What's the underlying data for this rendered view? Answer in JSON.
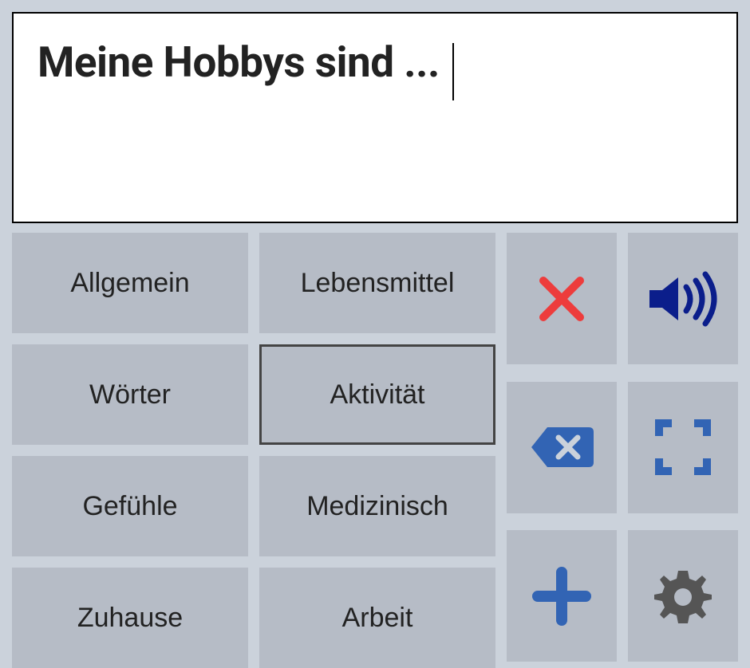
{
  "text_display": {
    "content": "Meine Hobbys sind ..."
  },
  "categories": [
    {
      "label": "Allgemein",
      "selected": false
    },
    {
      "label": "Lebensmittel",
      "selected": false
    },
    {
      "label": "Wörter",
      "selected": false
    },
    {
      "label": "Aktivität",
      "selected": true
    },
    {
      "label": "Gefühle",
      "selected": false
    },
    {
      "label": "Medizinisch",
      "selected": false
    },
    {
      "label": "Zuhause",
      "selected": false
    },
    {
      "label": "Arbeit",
      "selected": false
    }
  ],
  "actions": {
    "clear": "clear",
    "speak": "speak",
    "backspace": "backspace",
    "fullscreen": "fullscreen",
    "add": "add",
    "settings": "settings"
  },
  "colors": {
    "clear_icon": "#ed3c3c",
    "speak_icon": "#0b1e8b",
    "backspace_icon": "#3264b4",
    "fullscreen_icon": "#3264b4",
    "add_icon": "#3264b4",
    "settings_icon": "#555555"
  }
}
